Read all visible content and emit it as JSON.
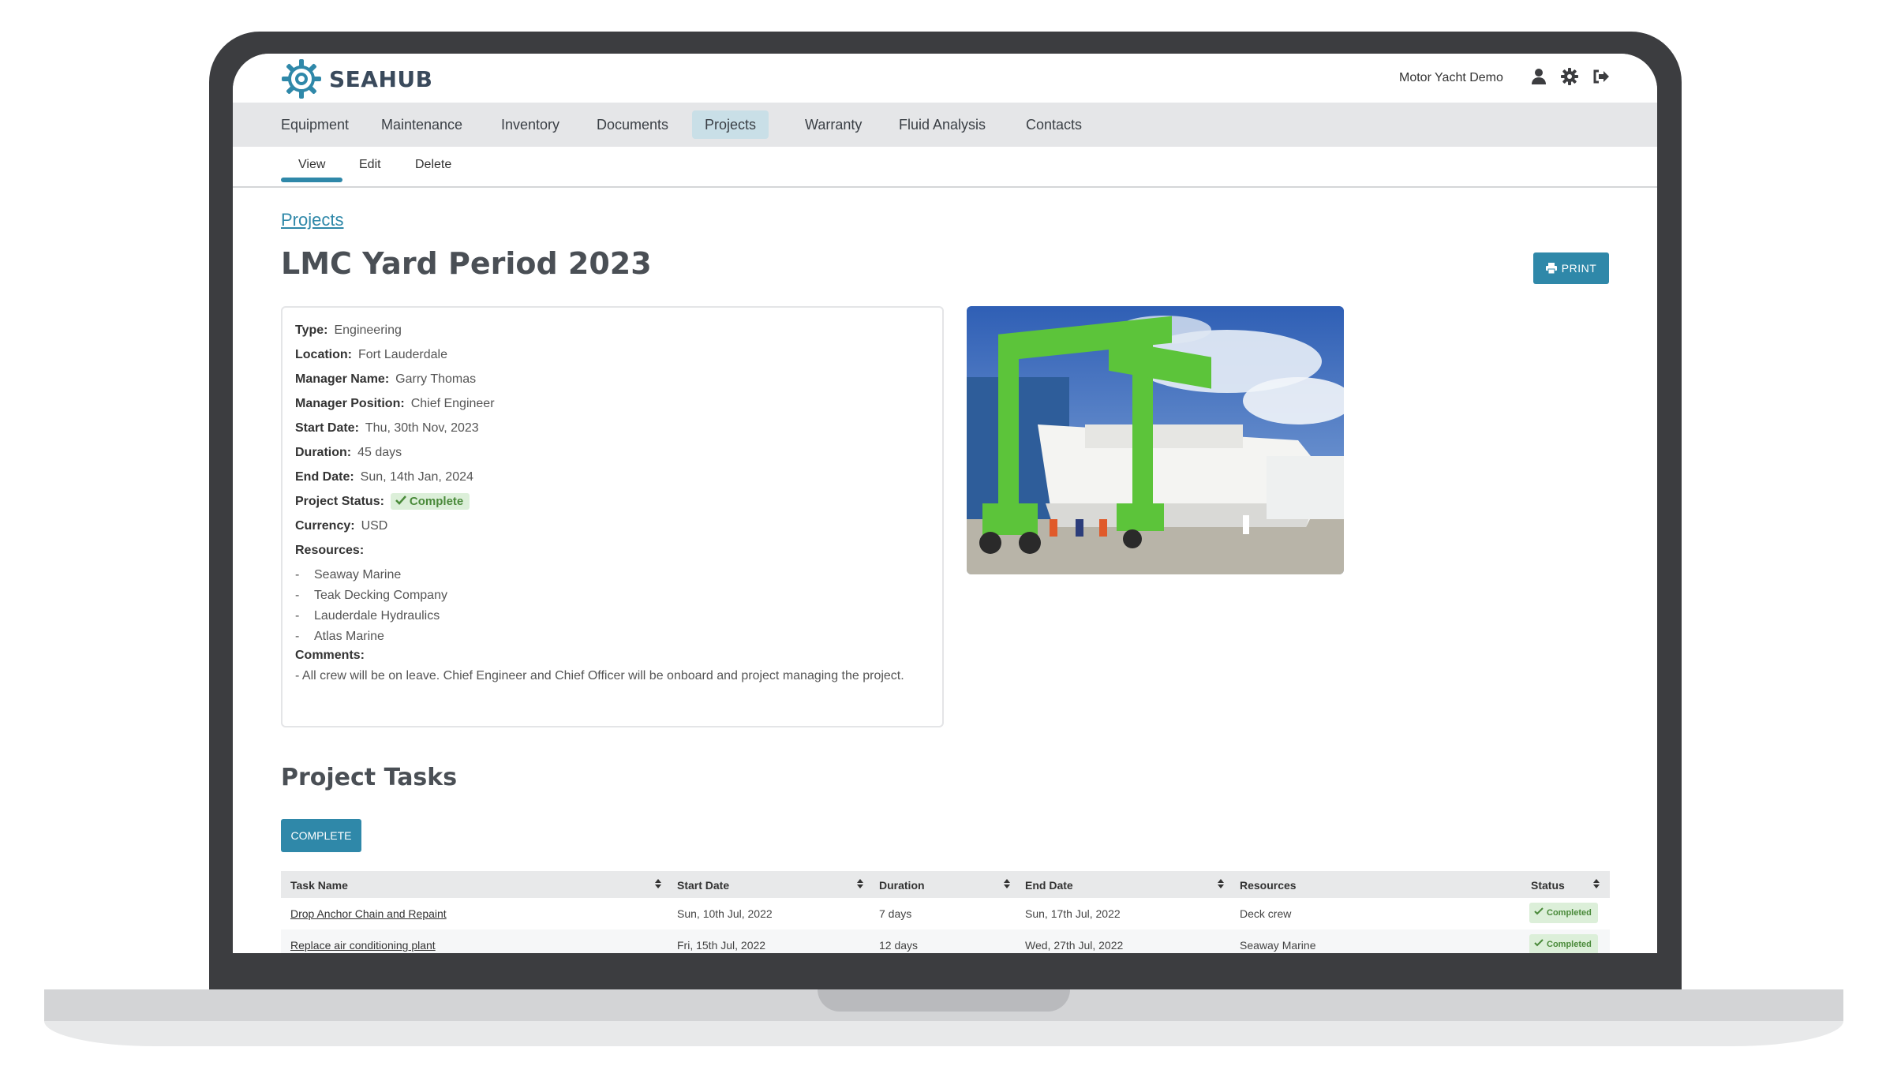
{
  "app": {
    "name": "SEAHUB",
    "vessel": "Motor Yacht Demo"
  },
  "nav": [
    "Equipment",
    "Maintenance",
    "Inventory",
    "Documents",
    "Projects",
    "Warranty",
    "Fluid Analysis",
    "Contacts"
  ],
  "subtabs": [
    "View",
    "Edit",
    "Delete"
  ],
  "breadcrumb": "Projects",
  "title": "LMC Yard Period 2023",
  "print_label": "PRINT",
  "details": {
    "type": {
      "label": "Type:",
      "value": "Engineering"
    },
    "location": {
      "label": "Location:",
      "value": "Fort Lauderdale"
    },
    "manager_name": {
      "label": "Manager Name:",
      "value": "Garry Thomas"
    },
    "manager_position": {
      "label": "Manager Position:",
      "value": "Chief Engineer"
    },
    "start_date": {
      "label": "Start Date:",
      "value": "Thu, 30th Nov, 2023"
    },
    "duration": {
      "label": "Duration:",
      "value": "45 days"
    },
    "end_date": {
      "label": "End Date:",
      "value": "Sun, 14th Jan, 2024"
    },
    "project_status": {
      "label": "Project Status:",
      "value": "Complete"
    },
    "currency": {
      "label": "Currency:",
      "value": "USD"
    },
    "resources_label": "Resources:",
    "resources": [
      "Seaway Marine",
      "Teak Decking Company",
      "Lauderdale Hydraulics",
      "Atlas Marine"
    ],
    "comments_label": "Comments:",
    "comments": "- All crew will be on leave. Chief Engineer and Chief Officer will be onboard and project managing the project."
  },
  "tasks": {
    "title": "Project Tasks",
    "complete_label": "COMPLETE",
    "columns": [
      "Task Name",
      "Start Date",
      "Duration",
      "End Date",
      "Resources",
      "Status"
    ],
    "rows": [
      {
        "name": "Drop Anchor Chain and Repaint",
        "start": "Sun, 10th Jul, 2022",
        "duration": "7 days",
        "end": "Sun, 17th Jul, 2022",
        "resources": "Deck crew",
        "status": "Completed"
      },
      {
        "name": "Replace air conditioning plant",
        "start": "Fri, 15th Jul, 2022",
        "duration": "12 days",
        "end": "Wed, 27th Jul, 2022",
        "resources": "Seaway Marine",
        "status": "Completed"
      }
    ]
  },
  "colors": {
    "accent": "#2f88a9",
    "status_green": "#4a8a3a",
    "status_bg": "#dcefd9"
  },
  "icons": [
    "user-icon",
    "gear-icon",
    "logout-icon",
    "printer-icon",
    "check-icon",
    "sort-icon"
  ]
}
